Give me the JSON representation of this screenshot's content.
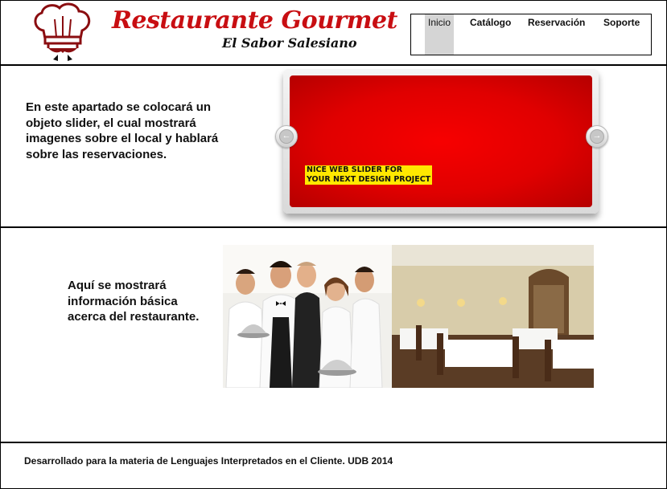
{
  "header": {
    "title": "Restaurante Gourmet",
    "subtitle": "El Sabor Salesiano",
    "logo_icon": "chef-hat-icon"
  },
  "nav": {
    "items": [
      {
        "label": "Inicio",
        "active": true
      },
      {
        "label": "Catálogo",
        "active": false
      },
      {
        "label": "Reservación",
        "active": false
      },
      {
        "label": "Soporte",
        "active": false
      }
    ]
  },
  "intro": {
    "text": "En este apartado se colocará un objeto slider, el cual mostrará imagenes sobre el local y hablará sobre las reservaciones."
  },
  "slider": {
    "caption_line1": "NICE WEB SLIDER FOR",
    "caption_line2": "YOUR NEXT DESIGN PROJECT",
    "prev_icon": "arrow-left-icon",
    "next_icon": "arrow-right-icon",
    "slide_color": "#e60000"
  },
  "about": {
    "text": "Aquí se mostrará información básica acerca del restaurante."
  },
  "footer": {
    "text": "Desarrollado para la materia de Lenguajes Interpretados en el Cliente. UDB 2014"
  },
  "colors": {
    "brand": "#c80e12",
    "caption_bg": "#ffe800"
  }
}
